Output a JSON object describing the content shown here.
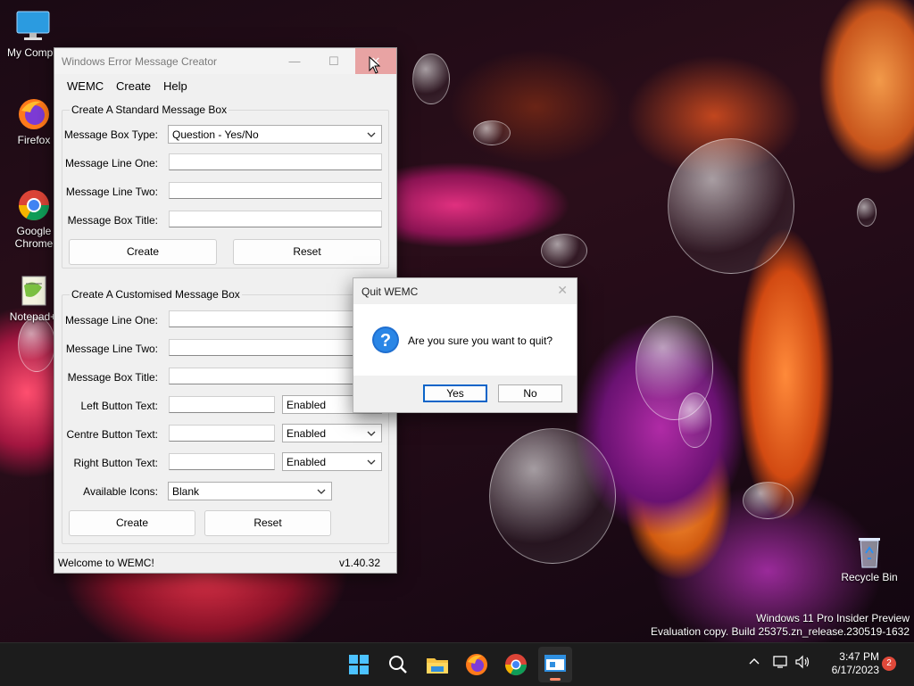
{
  "desktop": {
    "icons": [
      {
        "label": "My Compu"
      },
      {
        "label": "Firefox"
      },
      {
        "label": "Google Chrome"
      },
      {
        "label": "Notepad+"
      },
      {
        "label": "Recycle Bin"
      }
    ],
    "watermark_line1": "Windows 11 Pro Insider Preview",
    "watermark_line2": "Evaluation copy. Build 25375.zn_release.230519-1632"
  },
  "wemc": {
    "title": "Windows Error Message Creator",
    "menu": [
      "WEMC",
      "Create",
      "Help"
    ],
    "standard": {
      "group_label": "Create A Standard Message Box",
      "type_label": "Message Box Type:",
      "type_value": "Question - Yes/No",
      "line_one_label": "Message Line One:",
      "line_two_label": "Message Line Two:",
      "title_label": "Message Box Title:",
      "create_label": "Create",
      "reset_label": "Reset"
    },
    "custom": {
      "group_label": "Create A Customised Message Box",
      "line_one_label": "Message Line One:",
      "line_two_label": "Message Line Two:",
      "title_label": "Message Box Title:",
      "left_label": "Left Button Text:",
      "left_state": "Enabled",
      "centre_label": "Centre Button Text:",
      "centre_state": "Enabled",
      "right_label": "Right Button Text:",
      "right_state": "Enabled",
      "icons_label": "Available Icons:",
      "icons_value": "Blank",
      "create_label": "Create",
      "reset_label": "Reset"
    },
    "status_left": "Welcome to WEMC!",
    "status_right": "v1.40.32"
  },
  "dialog": {
    "title": "Quit WEMC",
    "message": "Are you sure you want to quit?",
    "yes_label": "Yes",
    "no_label": "No",
    "icon": "question-icon"
  },
  "taskbar": {
    "time": "3:47 PM",
    "date": "6/17/2023",
    "notification_count": "2",
    "apps": [
      "start-icon",
      "search-icon",
      "file-explorer-icon",
      "firefox-icon",
      "chrome-icon",
      "wemc-app-icon"
    ]
  }
}
